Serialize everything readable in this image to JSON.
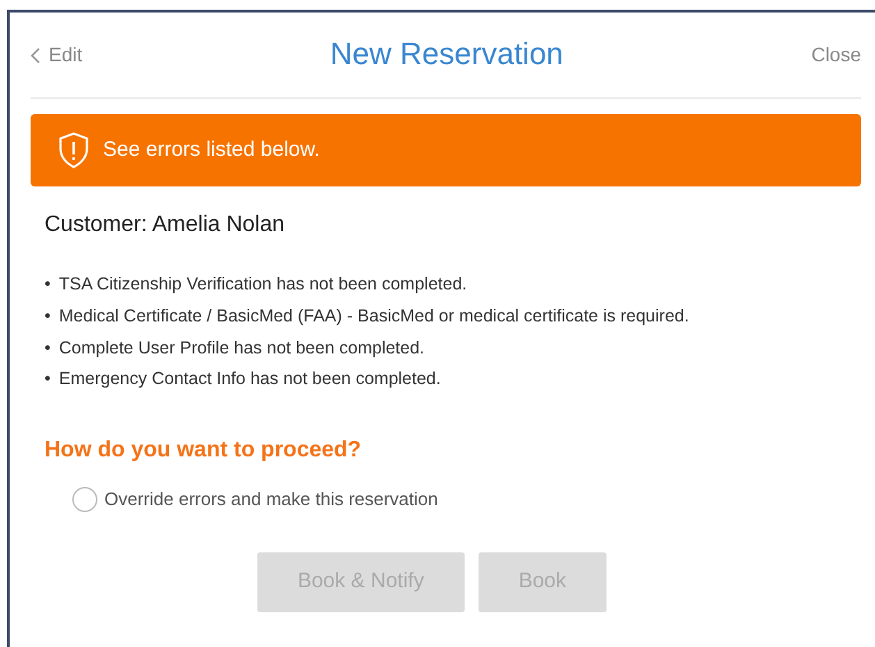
{
  "header": {
    "back": "Edit",
    "title": "New Reservation",
    "close": "Close"
  },
  "alert": {
    "text": "See errors listed below."
  },
  "customer": "Customer: Amelia Nolan",
  "errors": [
    {
      "bullet": "•",
      "text": "TSA Citizenship Verification has not been completed."
    },
    {
      "bullet": "•",
      "text": "Medical Certificate / BasicMed (FAA) - BasicMed or medical certificate is required."
    },
    {
      "bullet": "•",
      "text": "Complete User Profile has not been completed."
    },
    {
      "bullet": "•",
      "text": "Emergency Contact Info has not been completed."
    }
  ],
  "proceed": {
    "heading": "How do you want to proceed?",
    "options": [
      {
        "label": "Override errors and make this reservation",
        "checked": false
      }
    ]
  },
  "buttons": [
    {
      "label": "Book & Notify",
      "disabled": true
    },
    {
      "label": "Book",
      "disabled": true
    }
  ]
}
